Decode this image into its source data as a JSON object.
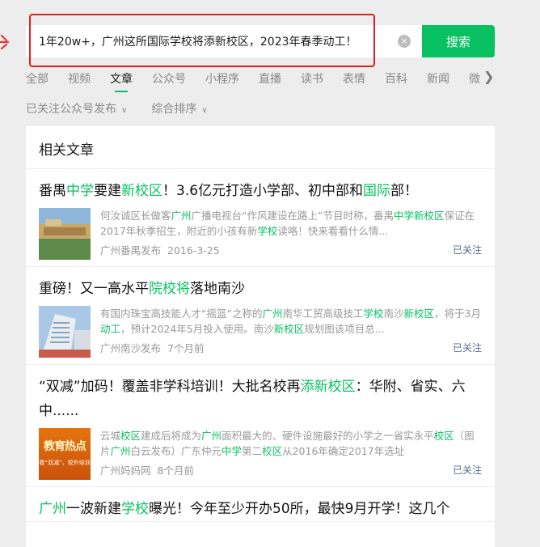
{
  "search": {
    "query": "1年20w+，广州这所国际学校将添新校区，2023年春季动工！",
    "clear_icon": "×",
    "button_label": "搜索"
  },
  "tabs": [
    "全部",
    "视频",
    "文章",
    "公众号",
    "小程序",
    "直播",
    "读书",
    "表情",
    "百科",
    "新闻",
    "微"
  ],
  "active_tab": "文章",
  "filters": {
    "source": "已关注公众号发布",
    "sort": "综合排序"
  },
  "section_title": "相关文章",
  "follow_label": "已关注",
  "articles": [
    {
      "title_parts": [
        {
          "t": "番禺",
          "h": false
        },
        {
          "t": "中学",
          "h": true
        },
        {
          "t": "要建",
          "h": false
        },
        {
          "t": "新校区",
          "h": true
        },
        {
          "t": "！3.6亿元打造小学部、初中部和",
          "h": false
        },
        {
          "t": "国际",
          "h": true
        },
        {
          "t": "部！",
          "h": false
        }
      ],
      "snippet_parts": [
        {
          "t": "何汝诚区长做客",
          "h": false
        },
        {
          "t": "广州",
          "h": true
        },
        {
          "t": "广播电视台“作风建设在路上”节目时称，番禺",
          "h": false
        },
        {
          "t": "中学新校区",
          "h": true
        },
        {
          "t": "保证在2017年秋季招生，附近的小孩有新",
          "h": false
        },
        {
          "t": "学校",
          "h": true
        },
        {
          "t": "读咯！快来看看什么情...",
          "h": false
        }
      ],
      "source": "广州番禺发布",
      "date": "2016-3-25",
      "thumb": "school-campus-image"
    },
    {
      "title_parts": [
        {
          "t": "重磅！又一高水平",
          "h": false
        },
        {
          "t": "院校将",
          "h": true
        },
        {
          "t": "落地南沙",
          "h": false
        }
      ],
      "snippet_parts": [
        {
          "t": "有国内珠宝高技能人才“摇篮”之称的",
          "h": false
        },
        {
          "t": "广州",
          "h": true
        },
        {
          "t": "南华工贸高级技工",
          "h": false
        },
        {
          "t": "学校",
          "h": true
        },
        {
          "t": "南沙",
          "h": false
        },
        {
          "t": "新校区",
          "h": true
        },
        {
          "t": "，将于3月",
          "h": false
        },
        {
          "t": "动工",
          "h": true
        },
        {
          "t": "，预计2024年5月投入使用。南沙",
          "h": false
        },
        {
          "t": "新校区",
          "h": true
        },
        {
          "t": "规划图该项目总...",
          "h": false
        }
      ],
      "source": "广州南沙发布",
      "date": "7个月前",
      "thumb": "building-image"
    },
    {
      "title_parts": [
        {
          "t": "“双减”加码！覆盖非学科培训！大批名校再",
          "h": false
        },
        {
          "t": "添新校区",
          "h": true
        },
        {
          "t": "：华附、省实、六中......",
          "h": false
        }
      ],
      "snippet_parts": [
        {
          "t": "云城",
          "h": false
        },
        {
          "t": "校区",
          "h": true
        },
        {
          "t": "建成后将成为",
          "h": false
        },
        {
          "t": "广州",
          "h": true
        },
        {
          "t": "面积最大的、硬件设施最好的小学之一省实永平",
          "h": false
        },
        {
          "t": "校区",
          "h": true
        },
        {
          "t": "（图片",
          "h": false
        },
        {
          "t": "广州",
          "h": true
        },
        {
          "t": "白云发布）广东仲元",
          "h": false
        },
        {
          "t": "中学",
          "h": true
        },
        {
          "t": "第二",
          "h": false
        },
        {
          "t": "校区",
          "h": true
        },
        {
          "t": "从2016年确定2017年选址",
          "h": false
        }
      ],
      "source": "广州妈妈网",
      "date": "8个月前",
      "thumb": "banner-image",
      "thumb_text": "教育热点",
      "thumb_sub": "看“双减”，校外培训"
    },
    {
      "title_parts": [
        {
          "t": "广州",
          "h": true
        },
        {
          "t": "一波新建",
          "h": false
        },
        {
          "t": "学校",
          "h": true
        },
        {
          "t": "曝光！今年至少开办50所，最快9月开学！这几个",
          "h": false
        }
      ]
    }
  ],
  "colors": {
    "accent": "#07c160",
    "highlight_box": "#e02020",
    "link": "#576b95"
  }
}
